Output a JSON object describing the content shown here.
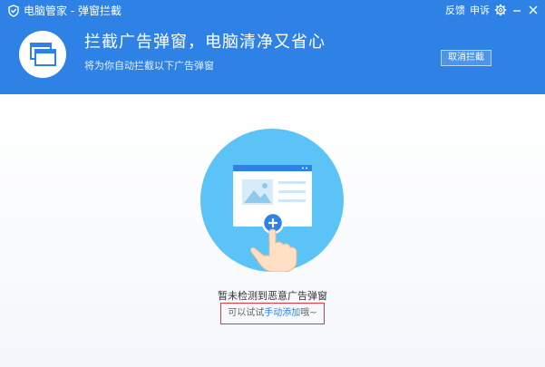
{
  "titlebar": {
    "app_title": "电脑管家 - 弹窗拦截",
    "feedback_label": "反馈",
    "complain_label": "申诉",
    "settings_icon": "gear-icon",
    "minimize_icon": "minimize-icon",
    "close_icon": "close-icon"
  },
  "header": {
    "title": "拦截广告弹窗，电脑清净又省心",
    "subtitle": "将为你自动拦截以下广告弹窗",
    "cancel_button_label": "取消拦截",
    "icon": "popup-windows-icon"
  },
  "main": {
    "illustration_icon": "hand-add-window-icon",
    "status_text": "暂未检测到恶意广告弹窗",
    "hint_prefix": "可以试试",
    "hint_link": "手动添加",
    "hint_suffix": "哦~"
  },
  "colors": {
    "header_blue": "#2e82e6",
    "circle_blue": "#5bc3f5",
    "highlight_red": "#e03b3b",
    "link_blue": "#2e82e6"
  }
}
